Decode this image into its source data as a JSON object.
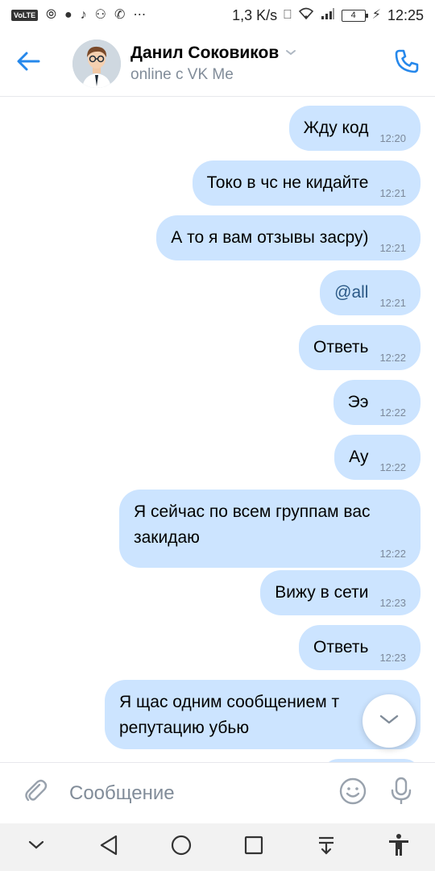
{
  "status_bar": {
    "volte": "VoLTE",
    "speed": "1,3 K/s",
    "battery": "4",
    "time": "12:25"
  },
  "header": {
    "name": "Данил Соковиков",
    "subtitle": "online с VK Me"
  },
  "messages": [
    {
      "text": "Жду код",
      "time": "12:20"
    },
    {
      "text": "Токо в чс не кидайте",
      "time": "12:21"
    },
    {
      "text": "А то я вам отзывы засру)",
      "time": "12:21"
    },
    {
      "text": "@all",
      "time": "12:21"
    },
    {
      "text": "Ответь",
      "time": "12:22"
    },
    {
      "text": "Ээ",
      "time": "12:22"
    },
    {
      "text": "Ау",
      "time": "12:22"
    },
    {
      "text_line1": "Я сейчас по всем группам вас",
      "text_line2": "закидаю",
      "time": "12:22"
    },
    {
      "text": "Вижу в сети",
      "time": "12:23"
    },
    {
      "text": "Ответь",
      "time": "12:23"
    },
    {
      "text_line1": "Я щас одним сообщением т",
      "text_line2": "репутацию убью"
    }
  ],
  "composer": {
    "placeholder": "Сообщение"
  },
  "colors": {
    "accent": "#2688eb",
    "bubble": "#cce4ff",
    "secondary_text": "#818c99"
  }
}
